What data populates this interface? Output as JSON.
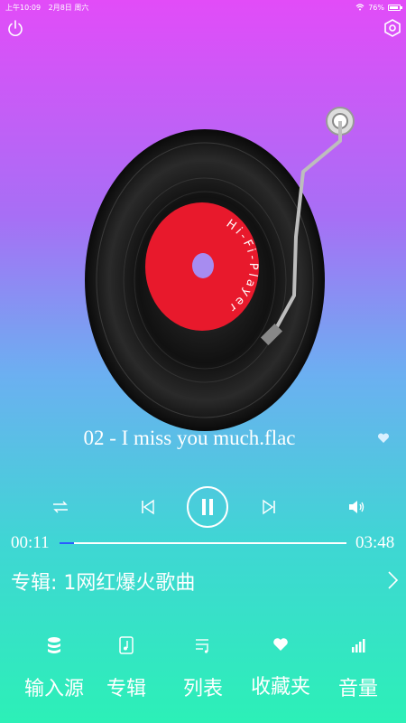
{
  "statusbar": {
    "time": "上午10:09",
    "date": "2月8日 周六",
    "battery": "76%"
  },
  "player": {
    "label_text": "Hi-Fi-Player",
    "track_title": "02 - I miss you much.flac",
    "current_time": "00:11",
    "total_time": "03:48",
    "progress": 0.05
  },
  "album": {
    "label": "专辑: 1网红爆火歌曲"
  },
  "nav": {
    "items": [
      {
        "label": "输入源",
        "icon": "database-icon"
      },
      {
        "label": "专辑",
        "icon": "music-note-icon"
      },
      {
        "label": "列表",
        "icon": "playlist-icon"
      },
      {
        "label": "收藏夹",
        "icon": "heart-icon"
      },
      {
        "label": "音量",
        "icon": "volume-bars-icon"
      }
    ]
  },
  "colors": {
    "gradient_top": "#e24cf8",
    "gradient_bottom": "#2cf0b7",
    "record_label": "#e8192c",
    "progress_fill": "#2a5cff"
  }
}
